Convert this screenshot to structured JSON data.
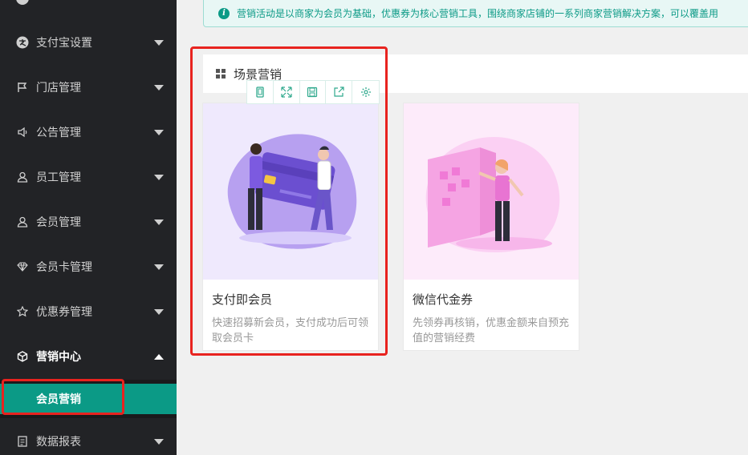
{
  "sidebar": {
    "items": [
      {
        "label": "支付宝设置",
        "icon": "alipay-icon"
      },
      {
        "label": "门店管理",
        "icon": "flag-icon"
      },
      {
        "label": "公告管理",
        "icon": "speaker-icon"
      },
      {
        "label": "员工管理",
        "icon": "user-icon"
      },
      {
        "label": "会员管理",
        "icon": "member-icon"
      },
      {
        "label": "会员卡管理",
        "icon": "diamond-icon"
      },
      {
        "label": "优惠券管理",
        "icon": "star-icon"
      },
      {
        "label": "营销中心",
        "icon": "cube-icon"
      },
      {
        "label": "数据报表",
        "icon": "report-icon"
      }
    ],
    "sub_item": "会员营销"
  },
  "notice": {
    "text": "营销活动是以商家为会员为基础，优惠券为核心营销工具，围绕商家店铺的一系列商家营销解决方案，可以覆盖用"
  },
  "section": {
    "title": "场景营销"
  },
  "toolbar": {
    "icons": [
      "mobile-icon",
      "expand-icon",
      "save-icon",
      "share-icon",
      "settings-icon"
    ]
  },
  "cards": [
    {
      "title": "支付即会员",
      "desc": "快速招募新会员，支付成功后可领取会员卡"
    },
    {
      "title": "微信代金券",
      "desc": "先领券再核销，优惠金额来自预充值的营销经费"
    }
  ],
  "colors": {
    "sidebar_bg": "#222326",
    "accent": "#0b9a86",
    "highlight": "#e8231f"
  }
}
